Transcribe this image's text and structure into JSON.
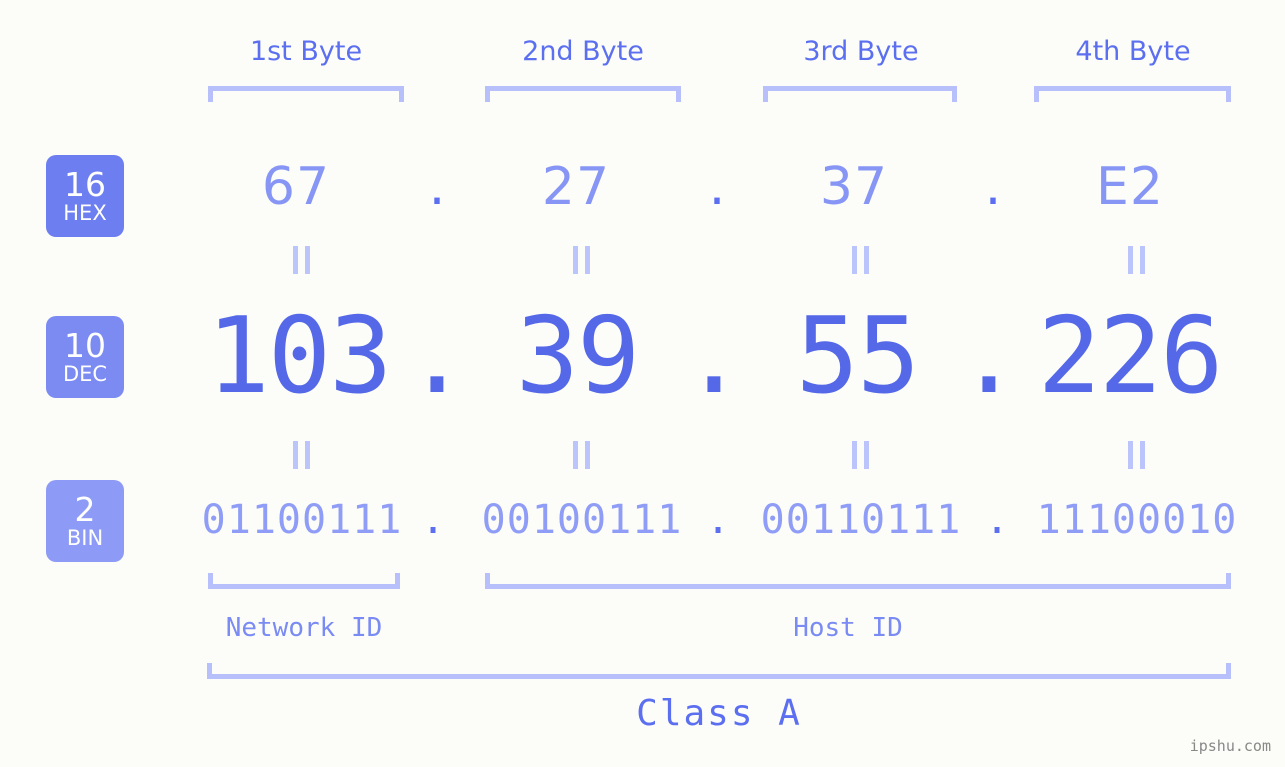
{
  "watermark": "ipshu.com",
  "byte_headers": [
    {
      "label": "1st Byte"
    },
    {
      "label": "2nd Byte"
    },
    {
      "label": "3rd Byte"
    },
    {
      "label": "4th Byte"
    }
  ],
  "radix_badges": [
    {
      "num": "16",
      "abbr": "HEX",
      "color": "#6c7ef0"
    },
    {
      "num": "10",
      "abbr": "DEC",
      "color": "#7b8bf2"
    },
    {
      "num": "2",
      "abbr": "BIN",
      "color": "#8d9bf6"
    }
  ],
  "separator": ".",
  "equals_mark": "||",
  "rows": {
    "hex": {
      "values": [
        "67",
        "27",
        "37",
        "E2"
      ]
    },
    "dec": {
      "values": [
        "103",
        "39",
        "55",
        "226"
      ]
    },
    "bin": {
      "values": [
        "01100111",
        "00100111",
        "00110111",
        "11100010"
      ]
    }
  },
  "ip": {
    "hex": "67.27.37.E2",
    "dec": "103.39.55.226",
    "bin": "01100111.00100111.00110111.11100010"
  },
  "sections": {
    "network_id": "Network ID",
    "host_id": "Host ID",
    "class": "Class A"
  },
  "colors": {
    "background": "#fcfdf8",
    "bracket": "#b7c0fb",
    "header_text": "#5b6ff0",
    "hex_text": "#8796f5",
    "dec_text": "#5568e8",
    "bin_text": "#8f9df6",
    "badge_hex": "#6c7ef0",
    "badge_dec": "#7b8bf2",
    "badge_bin": "#8d9bf6",
    "watermark": "#888888"
  }
}
